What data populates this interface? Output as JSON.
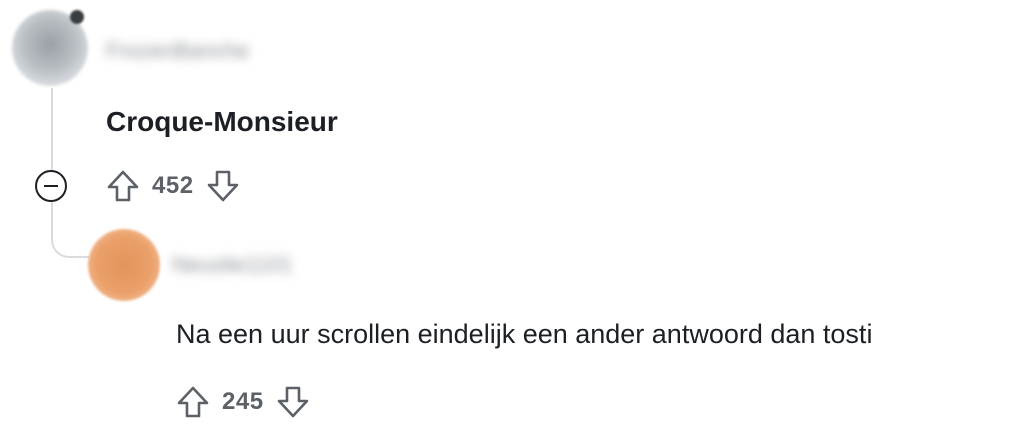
{
  "comments": [
    {
      "username": "FrozenBanche",
      "text": "Croque-Monsieur",
      "score": "452"
    },
    {
      "username": "Neuslie1101",
      "text": "Na een uur scrollen eindelijk een ander antwoord dan tosti",
      "score": "245"
    }
  ],
  "icons": {
    "upvote": "arrow-up-icon",
    "downvote": "arrow-down-icon",
    "collapse": "minus-circle-icon"
  },
  "colors": {
    "text": "#1c2024",
    "meta": "#5b6166",
    "thread_line": "#d9dcde"
  }
}
